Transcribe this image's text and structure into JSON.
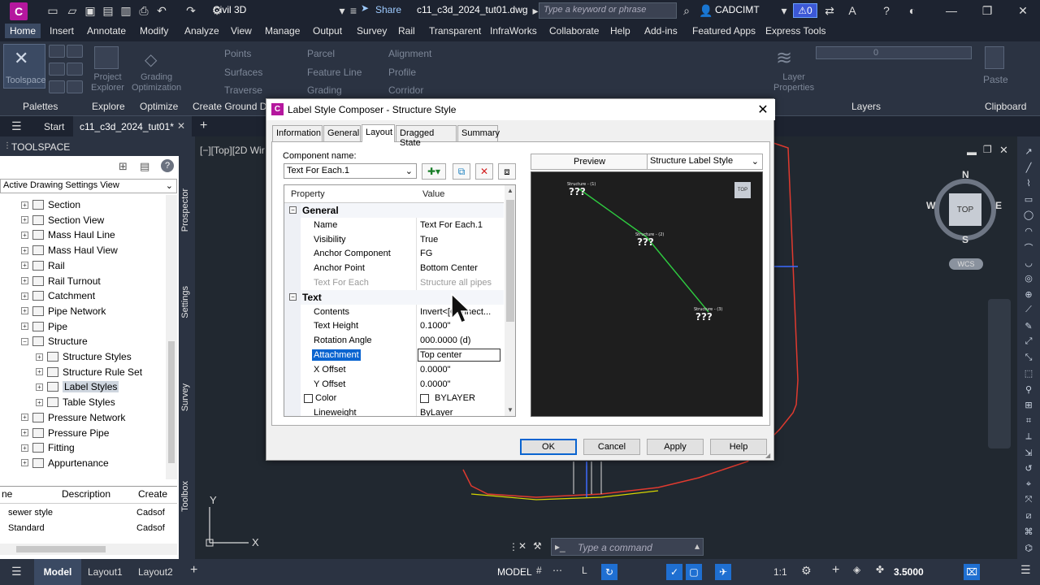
{
  "titlebar": {
    "app_letter": "C",
    "workspace": "Civil 3D",
    "share": "Share",
    "document": "c11_c3d_2024_tut01.dwg",
    "search_placeholder": "Type a keyword or phrase",
    "user": "CADCIMT",
    "alert_count": "0"
  },
  "ribbon_tabs": [
    "Home",
    "Insert",
    "Annotate",
    "Modify",
    "Analyze",
    "View",
    "Manage",
    "Output",
    "Survey",
    "Rail",
    "Transparent",
    "InfraWorks",
    "Collaborate",
    "Help",
    "Add-ins",
    "Featured Apps",
    "Express Tools"
  ],
  "ribbon": {
    "toolspace": "Toolspace",
    "project_explorer": "Project\nExplorer",
    "grading_optimization": "Grading\nOptimization",
    "points": "Points",
    "surfaces": "Surfaces",
    "traverse": "Traverse",
    "parcel": "Parcel",
    "feature_line": "Feature Line",
    "grading": "Grading",
    "alignment": "Alignment",
    "profile": "Profile",
    "corridor": "Corridor",
    "layer_properties": "Layer\nProperties",
    "paste": "Paste",
    "layer_value": "0",
    "groups": {
      "palettes": "Palettes",
      "explore": "Explore",
      "optimize": "Optimize",
      "create_ground": "Create Ground Da",
      "layers": "Layers",
      "clipboard": "Clipboard"
    }
  },
  "filetabs": {
    "start": "Start",
    "active": "c11_c3d_2024_tut01*"
  },
  "toolspace": {
    "title": "TOOLSPACE",
    "view_select": "Active Drawing Settings View",
    "tree": [
      {
        "label": "Section",
        "level": 1
      },
      {
        "label": "Section View",
        "level": 1
      },
      {
        "label": "Mass Haul Line",
        "level": 1
      },
      {
        "label": "Mass Haul View",
        "level": 1
      },
      {
        "label": "Rail",
        "level": 1
      },
      {
        "label": "Rail Turnout",
        "level": 1
      },
      {
        "label": "Catchment",
        "level": 1
      },
      {
        "label": "Pipe Network",
        "level": 1
      },
      {
        "label": "Pipe",
        "level": 1
      },
      {
        "label": "Structure",
        "level": 1
      },
      {
        "label": "Structure Styles",
        "level": 2
      },
      {
        "label": "Structure Rule Set",
        "level": 2
      },
      {
        "label": "Label Styles",
        "level": 2,
        "selected": true
      },
      {
        "label": "Table Styles",
        "level": 2
      },
      {
        "label": "Pressure Network",
        "level": 1
      },
      {
        "label": "Pressure Pipe",
        "level": 1
      },
      {
        "label": "Fitting",
        "level": 1
      },
      {
        "label": "Appurtenance",
        "level": 1
      }
    ],
    "vtabs": [
      "Prospector",
      "Settings",
      "Survey",
      "Toolbox"
    ],
    "table": {
      "headers": [
        "ne",
        "Description",
        "Create"
      ],
      "rows": [
        [
          "sewer style",
          "",
          "Cadsof"
        ],
        [
          "Standard",
          "",
          "Cadsof"
        ]
      ]
    }
  },
  "drawing": {
    "viewport_label": "[−][Top][2D Wir",
    "compass": {
      "n": "N",
      "s": "S",
      "e": "E",
      "w": "W",
      "top": "TOP",
      "wcs": "WCS"
    },
    "command_placeholder": "Type a command"
  },
  "dialog": {
    "title": "Label Style Composer - Structure Style",
    "tabs": [
      "Information",
      "General",
      "Layout",
      "Dragged State",
      "Summary"
    ],
    "active_tab": "Layout",
    "component_name_label": "Component name:",
    "component_name": "Text For Each.1",
    "grid_headers": {
      "property": "Property",
      "value": "Value"
    },
    "rows": [
      {
        "type": "cat",
        "name": "General"
      },
      {
        "name": "Name",
        "value": "Text For Each.1"
      },
      {
        "name": "Visibility",
        "value": "True"
      },
      {
        "name": "Anchor Component",
        "value": "FG"
      },
      {
        "name": "Anchor Point",
        "value": "Bottom Center"
      },
      {
        "name": "Text For Each",
        "value": "Structure all pipes",
        "dim": true
      },
      {
        "type": "cat",
        "name": "Text"
      },
      {
        "name": "Contents",
        "value": "Invert<[Connect..."
      },
      {
        "name": "Text Height",
        "value": "0.1000\""
      },
      {
        "name": "Rotation Angle",
        "value": "000.0000 (d)"
      },
      {
        "name": "Attachment",
        "value": "Top center",
        "highlight": true
      },
      {
        "name": "X Offset",
        "value": "0.0000\""
      },
      {
        "name": "Y Offset",
        "value": "0.0000\""
      },
      {
        "name": "Color",
        "value": "BYLAYER",
        "swatch": true
      },
      {
        "name": "Lineweight",
        "value": "ByLayer"
      }
    ],
    "preview_label": "Preview",
    "preview_style": "Structure Label Style",
    "preview_top": "TOP",
    "buttons": {
      "ok": "OK",
      "cancel": "Cancel",
      "apply": "Apply",
      "help": "Help"
    }
  },
  "statusbar": {
    "tabs": [
      "Model",
      "Layout1",
      "Layout2"
    ],
    "model": "MODEL",
    "scale": "1:1",
    "value": "3.5000"
  },
  "colors": {
    "accent": "#0a64d0",
    "app_logo": "#b5179e",
    "background": "#212830",
    "preview_line": "#2ecc40"
  }
}
